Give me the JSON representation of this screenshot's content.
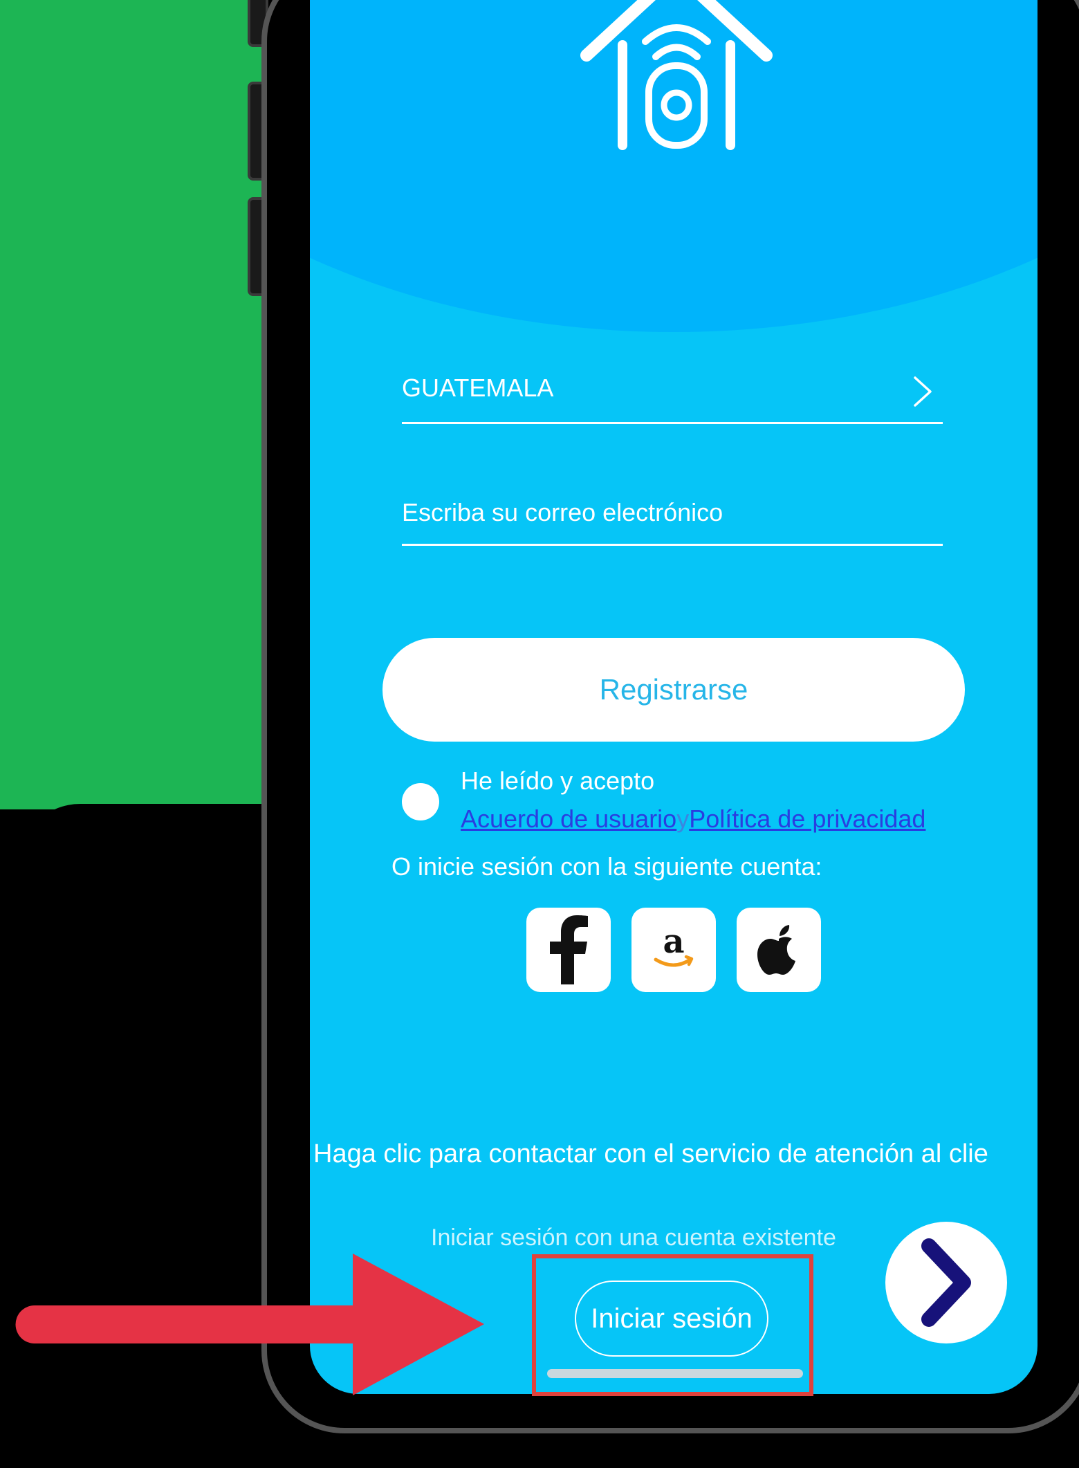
{
  "country_selector": {
    "value": "GUATEMALA"
  },
  "email_field": {
    "placeholder": "Escriba su correo electrónico"
  },
  "register_button": {
    "label": "Registrarse"
  },
  "agreement": {
    "accept_text": "He leído y acepto",
    "user_agreement_link": "Acuerdo de usuario",
    "separator": "y",
    "privacy_policy_link": "Política de privacidad"
  },
  "alt_login": {
    "prompt": "O inicie sesión con la siguiente cuenta:",
    "providers": [
      "facebook",
      "amazon",
      "apple"
    ]
  },
  "contact_support": {
    "text": "Haga clic para contactar con el servicio de atención al clie"
  },
  "existing_account": {
    "prompt": "Iniciar sesión con una cuenta existente",
    "signin_label": "Iniciar sesión"
  },
  "colors": {
    "screen_bg": "#06c5f7",
    "header_arc": "#00b4fb",
    "highlight": "#e0423c",
    "arrow": "#e53345",
    "next_chevron": "#17127a",
    "page_green": "#1db554"
  },
  "icons": [
    "smart-home-camera-logo",
    "chevron-right",
    "facebook",
    "amazon",
    "apple",
    "arrow-right",
    "next-chevron"
  ]
}
